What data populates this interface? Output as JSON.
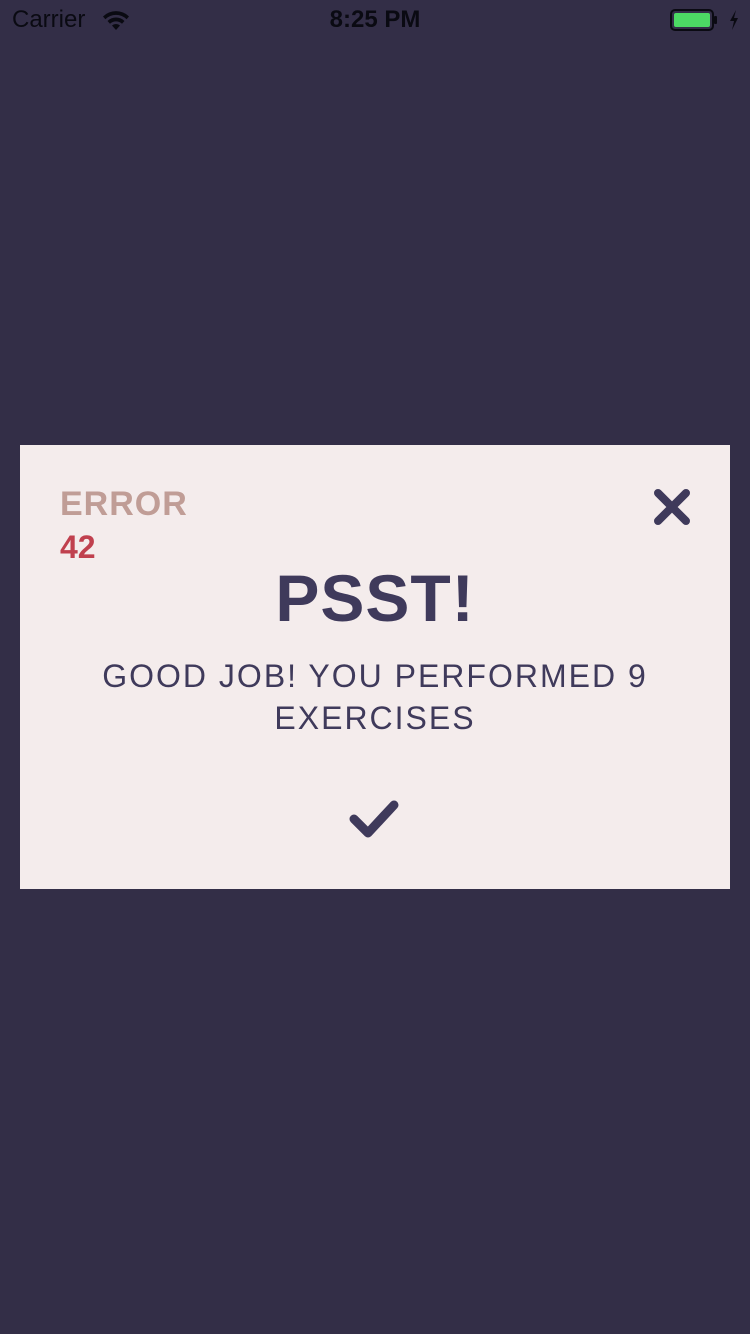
{
  "status_bar": {
    "carrier": "Carrier",
    "time": "8:25 PM",
    "battery_color": "#4cd964"
  },
  "dialog": {
    "error_label": "ERROR",
    "error_code": "42",
    "title": "PSST!",
    "message": "GOOD JOB! YOU PERFORMED 9 EXERCISES",
    "close_icon": "close-icon",
    "confirm_icon": "checkmark-icon"
  },
  "colors": {
    "background": "#332e47",
    "dialog_background": "#f4ecec",
    "primary_text": "#3f3a5b",
    "error_label": "#c09d96",
    "error_code": "#c0404e"
  }
}
